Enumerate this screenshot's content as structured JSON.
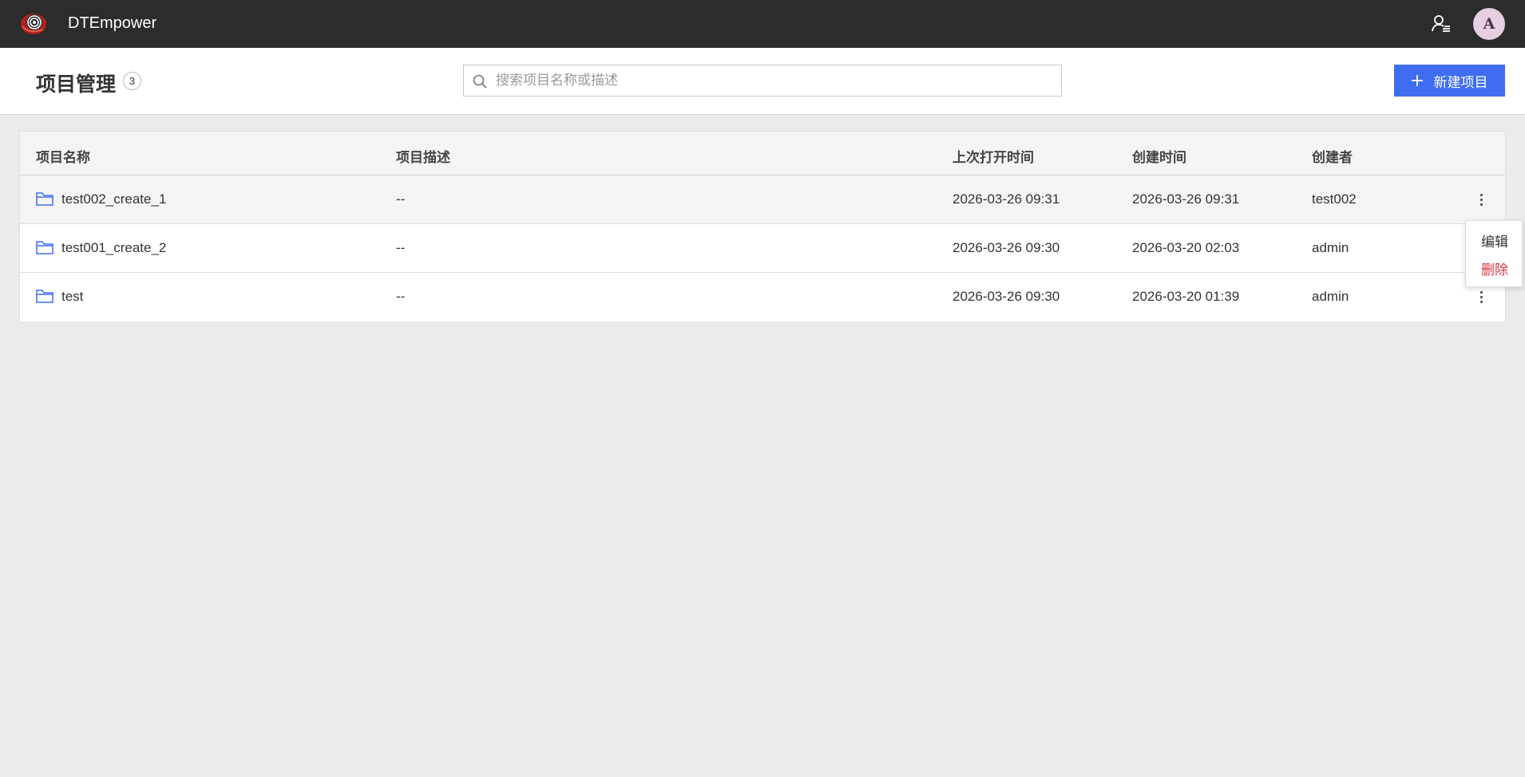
{
  "app": {
    "title": "DTEmpower",
    "avatar_letter": "A",
    "brand_color": "#2b2c2c",
    "logo_color": "#c7281f"
  },
  "header": {
    "title": "项目管理",
    "count": "3",
    "search": {
      "placeholder": "搜索项目名称或描述",
      "value": ""
    },
    "new_button_label": "新建项目",
    "accent_color": "#3f6df1"
  },
  "table": {
    "columns": {
      "name": "项目名称",
      "desc": "项目描述",
      "last_opened": "上次打开时间",
      "created": "创建时间",
      "creator": "创建者"
    },
    "rows": [
      {
        "name": "test002_create_1",
        "desc": "--",
        "last_opened": "2026-03-26 09:31",
        "created": "2026-03-26 09:31",
        "creator": "test002"
      },
      {
        "name": "test001_create_2",
        "desc": "--",
        "last_opened": "2026-03-26 09:30",
        "created": "2026-03-20 02:03",
        "creator": "admin"
      },
      {
        "name": "test",
        "desc": "--",
        "last_opened": "2026-03-26 09:30",
        "created": "2026-03-20 01:39",
        "creator": "admin"
      }
    ]
  },
  "context_menu": {
    "edit": "编辑",
    "delete": "删除",
    "delete_color": "#d9363e"
  },
  "icons": {
    "logo": "target-spiral-icon",
    "user_list": "user-list-icon",
    "search": "search-icon",
    "plus": "plus-icon",
    "folder": "folder-icon",
    "more": "more-vertical-icon"
  }
}
